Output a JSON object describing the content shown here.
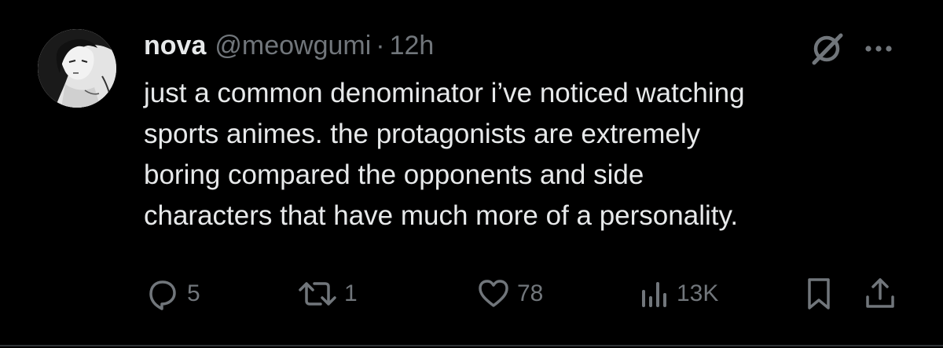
{
  "tweet": {
    "display_name": "nova",
    "handle": "@meowgumi",
    "separator": "·",
    "time": "12h",
    "text": "just a common denominator i’ve noticed watching\nsports animes. the protagonists are extremely\nboring compared the opponents and side\ncharacters that have much more of a personality."
  },
  "actions": {
    "replies": "5",
    "reposts": "1",
    "likes": "78",
    "views": "13K"
  },
  "icons": {
    "reply": "reply-icon",
    "repost": "repost-icon",
    "like": "heart-icon",
    "views": "views-icon",
    "bookmark": "bookmark-icon",
    "share": "share-icon",
    "grok": "grok-icon",
    "more": "more-icon"
  },
  "colors": {
    "background": "#000000",
    "primary_text": "#e7e9ea",
    "secondary_text": "#71767b",
    "divider": "#2f3336"
  }
}
